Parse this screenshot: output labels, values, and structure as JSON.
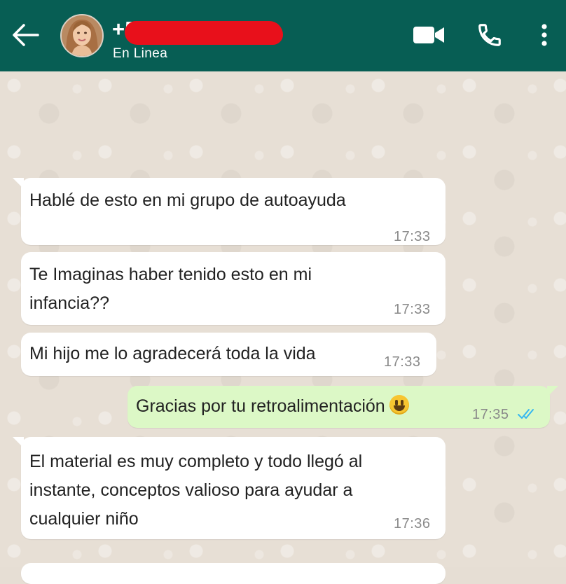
{
  "header": {
    "contact_name": "+5",
    "status": "En Linea"
  },
  "icons": {
    "back": "arrow-left-icon",
    "video": "video-camera-icon",
    "call": "phone-icon",
    "menu": "more-vertical-icon",
    "read_receipt": "double-check-icon",
    "emoji": "smiling-face-emoji"
  },
  "colors": {
    "header": "#075e54",
    "incoming_bubble": "#ffffff",
    "outgoing_bubble": "#dcf8c6",
    "read_check": "#34b7f1"
  },
  "messages": [
    {
      "direction": "in",
      "lines": [
        "Hablé de esto en mi grupo de autoayuda"
      ],
      "time": "17:33"
    },
    {
      "direction": "in",
      "lines": [
        "Te Imaginas haber tenido esto en mi",
        "infancia??"
      ],
      "time": "17:33"
    },
    {
      "direction": "in",
      "lines": [
        "Mi hijo me lo agradecerá toda la vida"
      ],
      "time": "17:33"
    },
    {
      "direction": "out",
      "lines": [
        "Gracias por tu retroalimentación"
      ],
      "time": "17:35"
    },
    {
      "direction": "in",
      "lines": [
        "El material es muy completo y todo llegó al",
        "instante, conceptos valioso para ayudar a",
        "cualquier niño"
      ],
      "time": "17:36"
    }
  ]
}
